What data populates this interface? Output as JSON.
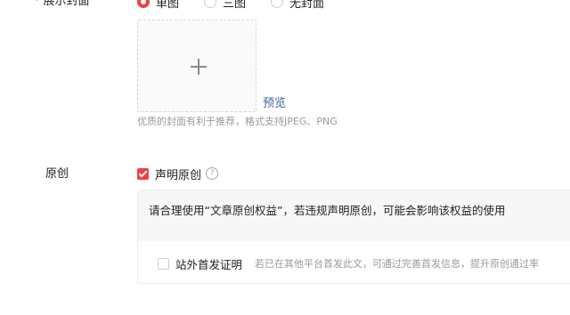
{
  "cover": {
    "required_mark": "*",
    "label": "展示封面",
    "options": [
      {
        "label": "单图",
        "checked": true
      },
      {
        "label": "三图",
        "checked": false
      },
      {
        "label": "无封面",
        "checked": false
      }
    ],
    "preview_link": "预览",
    "hint": "优质的封面有利于推荐，格式支持JPEG、PNG"
  },
  "original": {
    "label": "原创",
    "declare_label": "声明原创",
    "declare_checked": true,
    "help_glyph": "?",
    "notice": "请合理使用“文章原创权益”，若违规声明原创，可能会影响该权益的使用",
    "first_publish_label": "站外首发证明",
    "first_publish_checked": false,
    "first_publish_hint": "若已在其他平台首发此文，可通过完善首发信息，提升原创通过率"
  },
  "colors": {
    "accent": "#f04142",
    "link": "#406599",
    "hint": "#999999",
    "text": "#222222"
  }
}
